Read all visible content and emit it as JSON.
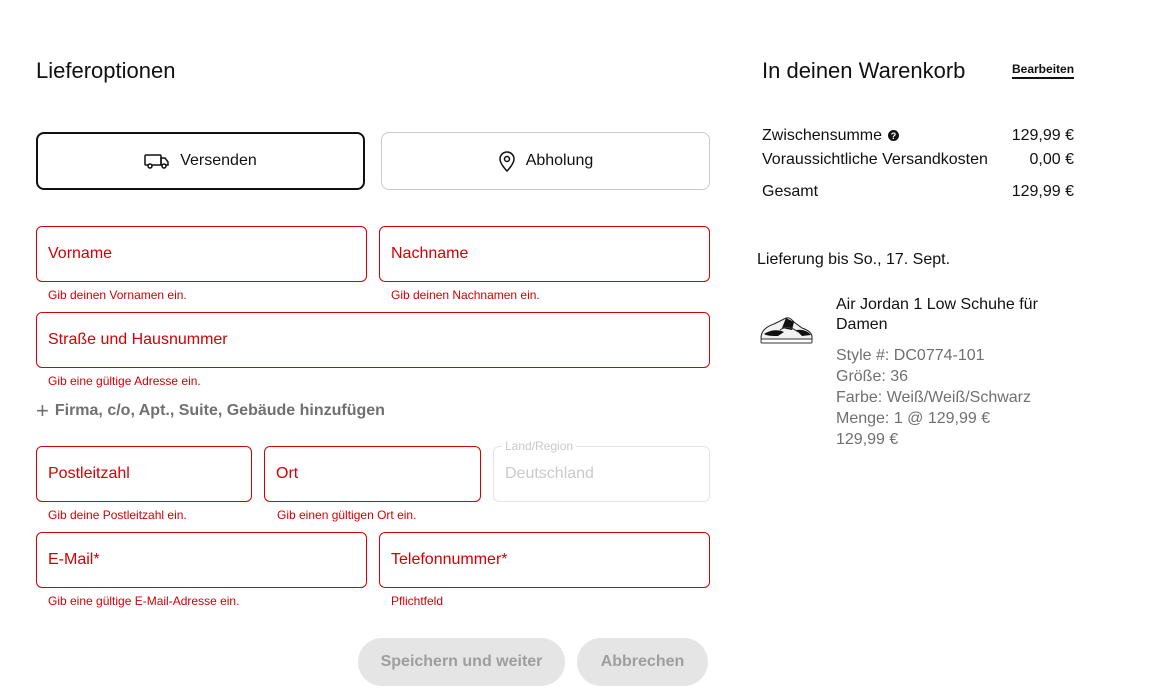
{
  "delivery": {
    "title": "Lieferoptionen",
    "option_ship": "Versenden",
    "option_pickup": "Abholung"
  },
  "form": {
    "first_name": {
      "label": "Vorname",
      "error": "Gib deinen Vornamen ein."
    },
    "last_name": {
      "label": "Nachname",
      "error": "Gib deinen Nachnamen ein."
    },
    "street": {
      "label": "Straße und Hausnummer",
      "error": "Gib eine gültige Adresse ein."
    },
    "add_line": "Firma, c/o, Apt., Suite, Gebäude hinzufügen",
    "add_line_icon": "plus",
    "postal": {
      "label": "Postleitzahl",
      "error": "Gib deine Postleitzahl ein."
    },
    "city": {
      "label": "Ort",
      "error": "Gib einen gültigen Ort ein."
    },
    "country": {
      "label": "Land/Region",
      "value": "Deutschland"
    },
    "email": {
      "label": "E-Mail*",
      "error": "Gib eine gültige E-Mail-Adresse ein."
    },
    "phone": {
      "label": "Telefonnummer*",
      "error": "Pflichtfeld"
    },
    "save_button": "Speichern und weiter",
    "cancel_button": "Abbrechen"
  },
  "cart": {
    "title": "In deinen Warenkorb",
    "edit_link": "Bearbeiten",
    "subtotal_label": "Zwischensumme",
    "subtotal_value": "129,99 €",
    "shipping_label": "Voraussichtliche Versandkosten",
    "shipping_value": "0,00 €",
    "total_label": "Gesamt",
    "total_value": "129,99 €",
    "delivery_date": "Lieferung bis So., 17. Sept.",
    "product": {
      "name": "Air Jordan 1 Low Schuhe für Damen",
      "style": "Style #: DC0774-101",
      "size": "Größe: 36",
      "color": "Farbe: Weiß/Weiß/Schwarz",
      "qty": "Menge: 1 @ 129,99 €",
      "price": "129,99 €"
    }
  },
  "colors": {
    "error_red": "#d30005",
    "text_dark": "#111111",
    "text_gray": "#707072",
    "border_light": "#cacacb",
    "button_disabled_bg": "#e5e5e5"
  }
}
